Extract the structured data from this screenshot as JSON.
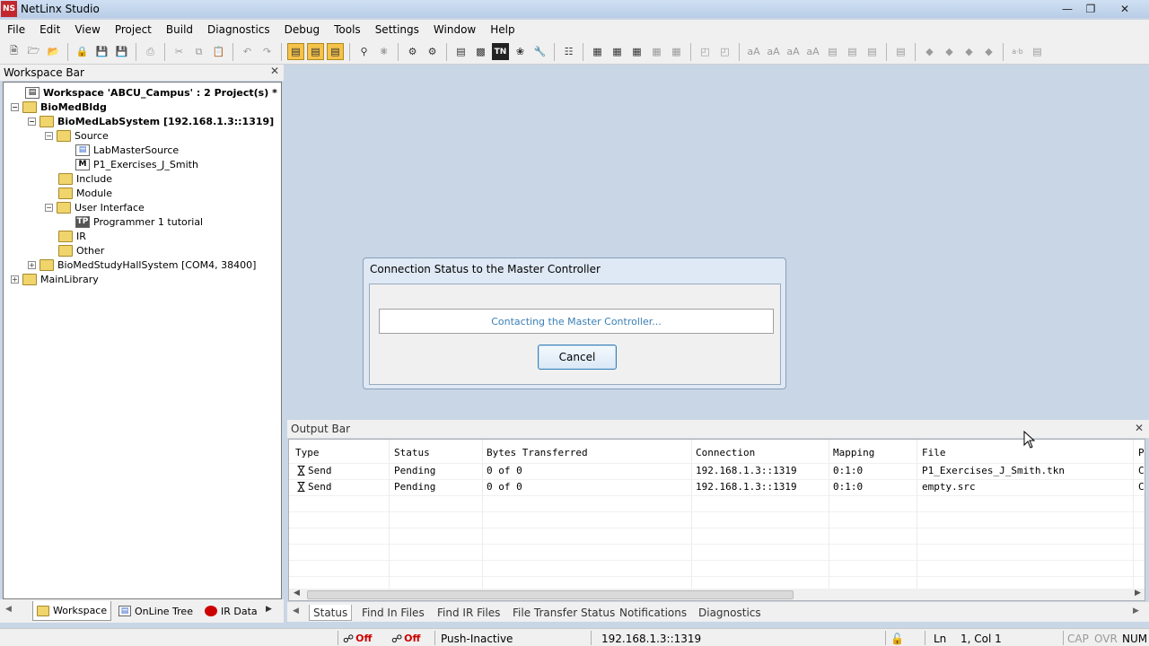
{
  "window": {
    "title": "NetLinx Studio",
    "app_icon": "NS"
  },
  "menu": [
    "File",
    "Edit",
    "View",
    "Project",
    "Build",
    "Diagnostics",
    "Debug",
    "Tools",
    "Settings",
    "Window",
    "Help"
  ],
  "workspace_bar": {
    "title": "Workspace Bar",
    "tree": {
      "workspace": "Workspace 'ABCU_Campus' : 2 Project(s) *",
      "project1": "BioMedBldg",
      "system1": "BioMedLabSystem [192.168.1.3::1319]",
      "source": "Source",
      "source_file1": "LabMasterSource",
      "source_file2": "P1_Exercises_J_Smith",
      "include": "Include",
      "module": "Module",
      "user_interface": "User Interface",
      "ui_file": "Programmer 1 tutorial",
      "ir": "IR",
      "other": "Other",
      "system2": "BioMedStudyHallSystem [COM4, 38400]",
      "library": "MainLibrary"
    },
    "tabs": [
      "Workspace",
      "OnLine Tree",
      "IR Data"
    ]
  },
  "dialog": {
    "title": "Connection Status to the Master Controller",
    "message": "Contacting the Master Controller...",
    "cancel_label": "Cancel"
  },
  "output_bar": {
    "title": "Output Bar",
    "columns": [
      "Type",
      "Status",
      "Bytes Transferred",
      "Connection",
      "Mapping",
      "File",
      "P"
    ],
    "rows": [
      [
        "Send",
        "Pending",
        "0 of 0",
        "192.168.1.3::1319",
        "0:1:0",
        "P1_Exercises_J_Smith.tkn",
        "C"
      ],
      [
        "Send",
        "Pending",
        "0 of 0",
        "192.168.1.3::1319",
        "0:1:0",
        "empty.src",
        "C"
      ]
    ],
    "tabs": [
      "Status",
      "Find In Files",
      "Find IR Files",
      "File Transfer Status",
      "Notifications",
      "Diagnostics"
    ]
  },
  "statusbar": {
    "off1": "Off",
    "off2": "Off",
    "push": "Push-Inactive",
    "ip": "192.168.1.3::1319",
    "ln": "Ln",
    "pos": "1, Col  1",
    "cap": "CAP",
    "ovr": "OVR",
    "num": "NUM"
  }
}
